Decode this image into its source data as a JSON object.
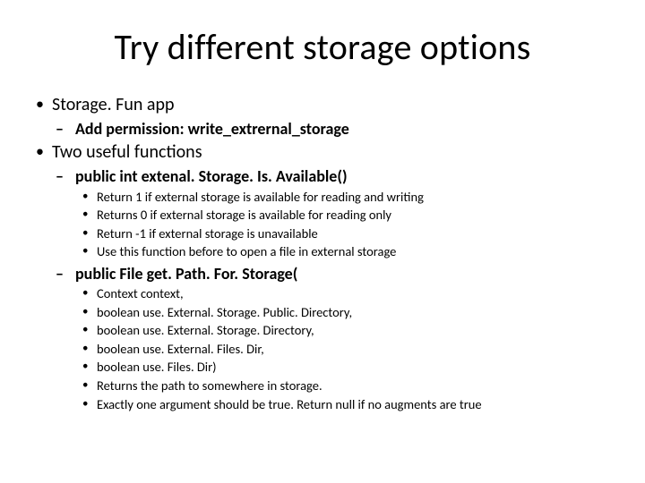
{
  "title": "Try different storage options",
  "b1": {
    "label": "Storage. Fun app",
    "sub1": "Add permission: write_extrernal_storage"
  },
  "b2": {
    "label": "Two useful functions",
    "f1": {
      "sig": "public int extenal. Storage. Is. Available()",
      "p1": "Return 1 if external storage is available for reading and writing",
      "p2": "Returns 0 if external storage is available for reading only",
      "p3": "Return -1 if external storage is unavailable",
      "p4": "Use this function before to open a file in external storage"
    },
    "f2": {
      "sig": "public File get. Path. For. Storage(",
      "p1": "Context context,",
      "p2": "boolean use. External. Storage. Public. Directory,",
      "p3": "boolean use. External. Storage. Directory,",
      "p4": "boolean use. External. Files. Dir,",
      "p5": "boolean use. Files. Dir)",
      "p6": "Returns the path to somewhere in storage.",
      "p7": "Exactly one argument should be true. Return null if no augments are true"
    }
  }
}
